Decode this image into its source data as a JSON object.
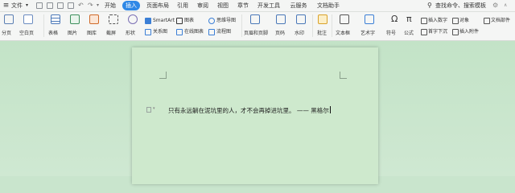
{
  "menubar": {
    "file_label": "文件",
    "tabs": [
      "开始",
      "插入",
      "页面布局",
      "引用",
      "审阅",
      "视图",
      "章节",
      "开发工具",
      "云服务",
      "文档助手"
    ],
    "active_tab": "插入",
    "search_label": "查找命令、搜索模板"
  },
  "ribbon": {
    "page_break": "分页",
    "blank_page": "空白页",
    "table": "表格",
    "picture": "图片",
    "gallery": "图库",
    "screenshot": "截屏",
    "shape": "形状",
    "smartart": "SmartArt",
    "chart": "图表",
    "relation_chart": "关系图",
    "online_chart": "在线图表",
    "mindmap": "思维导图",
    "flowchart": "流程图",
    "header_footer": "页眉和页脚",
    "page_number": "页码",
    "watermark": "水印",
    "comment": "批注",
    "textbox": "文本框",
    "wordart": "艺术字",
    "symbol": "符号",
    "formula": "公式",
    "insert_number": "插入数字",
    "object": "对象",
    "drop_cap": "首字下沉",
    "attachment": "插入附件",
    "doc_parts": "文档部件"
  },
  "document": {
    "text": "只有永远躺在泥坑里的人，才不会再掉进坑里。 —— 黑格尔"
  },
  "colors": {
    "accent": "#2f88e6",
    "workspace": "#c9e5cd",
    "page": "#cee9cd"
  }
}
